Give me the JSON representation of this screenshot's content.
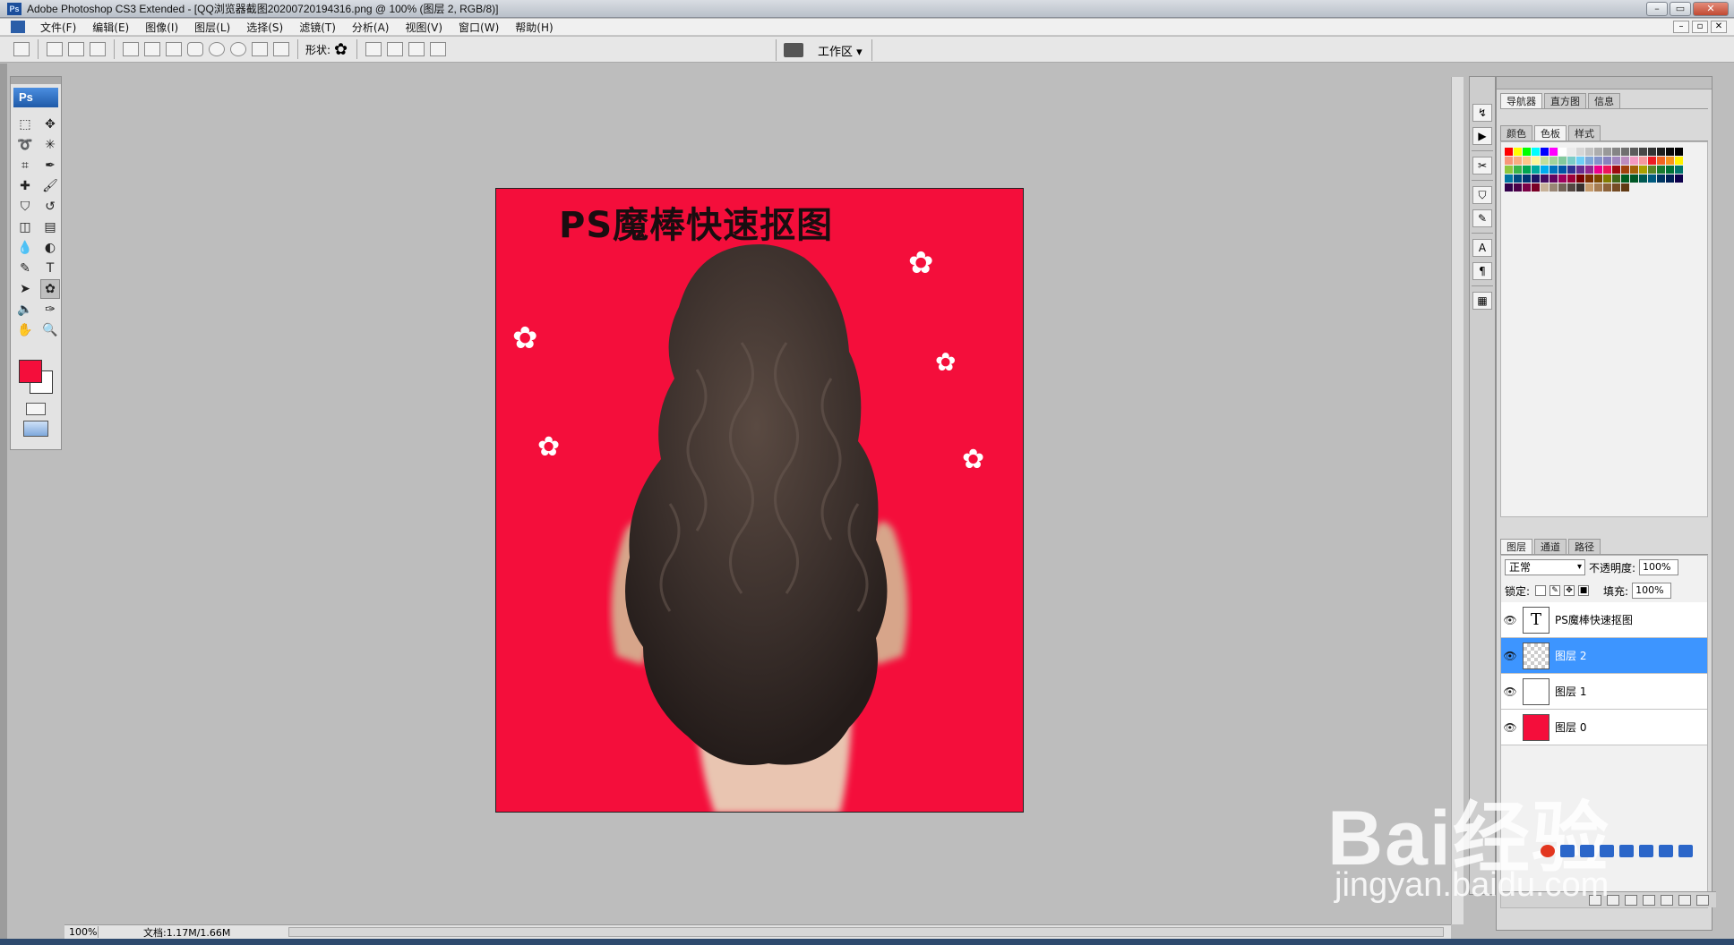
{
  "window": {
    "title": "Adobe Photoshop CS3 Extended - [QQ浏览器截图20200720194316.png @ 100% (图层 2, RGB/8)]",
    "ps_mark": "Ps"
  },
  "menu": [
    "文件(F)",
    "编辑(E)",
    "图像(I)",
    "图层(L)",
    "选择(S)",
    "滤镜(T)",
    "分析(A)",
    "视图(V)",
    "窗口(W)",
    "帮助(H)"
  ],
  "options_bar": {
    "shape_label": "形状:",
    "shape_glyph": "✿",
    "workspace_label": "工作区 ▾"
  },
  "toolbox": {
    "logo": "Ps",
    "foreground_color": "#f40e3b",
    "background_color": "#ffffff",
    "tools": [
      {
        "name": "marquee-tool-icon",
        "glyph": "⬚"
      },
      {
        "name": "move-tool-icon",
        "glyph": "✥"
      },
      {
        "name": "lasso-tool-icon",
        "glyph": "➰"
      },
      {
        "name": "magic-wand-tool-icon",
        "glyph": "✳"
      },
      {
        "name": "crop-tool-icon",
        "glyph": "⌗"
      },
      {
        "name": "slice-tool-icon",
        "glyph": "✒"
      },
      {
        "name": "healing-brush-icon",
        "glyph": "✚"
      },
      {
        "name": "brush-tool-icon",
        "glyph": "🖌"
      },
      {
        "name": "clone-stamp-icon",
        "glyph": "⛉"
      },
      {
        "name": "history-brush-icon",
        "glyph": "↺"
      },
      {
        "name": "eraser-tool-icon",
        "glyph": "◫"
      },
      {
        "name": "gradient-tool-icon",
        "glyph": "▤"
      },
      {
        "name": "blur-tool-icon",
        "glyph": "💧"
      },
      {
        "name": "dodge-tool-icon",
        "glyph": "◐"
      },
      {
        "name": "pen-tool-icon",
        "glyph": "✎"
      },
      {
        "name": "type-tool-icon",
        "glyph": "T"
      },
      {
        "name": "path-selection-icon",
        "glyph": "➤"
      },
      {
        "name": "custom-shape-tool-icon",
        "glyph": "✿"
      },
      {
        "name": "notes-tool-icon",
        "glyph": "🔈"
      },
      {
        "name": "eyedropper-tool-icon",
        "glyph": "✑"
      },
      {
        "name": "hand-tool-icon",
        "glyph": "✋"
      },
      {
        "name": "zoom-tool-icon",
        "glyph": "🔍"
      }
    ]
  },
  "canvas": {
    "text": "PS魔棒快速抠图",
    "background_color": "#f40e3b",
    "flower_glyph": "✿"
  },
  "status": {
    "zoom": "100%",
    "doc": "文档:1.17M/1.66M"
  },
  "panels": {
    "top_tabs": [
      "导航器",
      "直方图",
      "信息"
    ],
    "color_tabs": [
      "颜色",
      "色板",
      "样式"
    ],
    "layer_tabs": [
      "图层",
      "通道",
      "路径"
    ],
    "blend_mode": "正常",
    "opacity_label": "不透明度:",
    "opacity_value": "100%",
    "lock_label": "锁定:",
    "fill_label": "填充:",
    "fill_value": "100%",
    "layers": [
      {
        "name": "PS魔棒快速抠图",
        "thumb": "text",
        "thumb_glyph": "T",
        "selected": false
      },
      {
        "name": "图层 2",
        "thumb": "checker",
        "thumb_glyph": "",
        "selected": true
      },
      {
        "name": "图层 1",
        "thumb": "hair",
        "thumb_glyph": "",
        "selected": false
      },
      {
        "name": "图层 0",
        "thumb": "red",
        "thumb_glyph": "",
        "selected": false
      }
    ],
    "swatches": [
      "#ff0000",
      "#ffff00",
      "#00ff00",
      "#00ffff",
      "#0000ff",
      "#ff00ff",
      "#ffffff",
      "#ebebeb",
      "#d6d6d6",
      "#c2c2c2",
      "#adadad",
      "#999999",
      "#858585",
      "#707070",
      "#5c5c5c",
      "#474747",
      "#333333",
      "#1f1f1f",
      "#0a0a0a",
      "#000000",
      "#f7977a",
      "#f9ad81",
      "#fdc68a",
      "#fff79a",
      "#c4df9b",
      "#a2d39c",
      "#82ca9d",
      "#7bcdc8",
      "#6ecff6",
      "#7ea7d8",
      "#8493ca",
      "#8882be",
      "#a187be",
      "#bc8dbf",
      "#f49ac2",
      "#f6989d",
      "#ed1c24",
      "#f26522",
      "#f7941d",
      "#fff200",
      "#8dc73f",
      "#39b54a",
      "#00a651",
      "#00a99d",
      "#00aeef",
      "#0072bc",
      "#0054a6",
      "#2e3192",
      "#662d91",
      "#92278f",
      "#ec008c",
      "#ed145b",
      "#9e0b0f",
      "#a0410d",
      "#a3620a",
      "#aba000",
      "#598527",
      "#197b30",
      "#007236",
      "#00746b",
      "#0076a3",
      "#004a80",
      "#003471",
      "#1b1464",
      "#440e62",
      "#630460",
      "#9e005d",
      "#9e0039",
      "#790000",
      "#7b2e00",
      "#7d4900",
      "#827b00",
      "#406618",
      "#005e20",
      "#005826",
      "#005952",
      "#005b7f",
      "#003663",
      "#002157",
      "#0d004c",
      "#32004b",
      "#4b0049",
      "#7b0046",
      "#7a0026",
      "#c7b299",
      "#998675",
      "#736357",
      "#534741",
      "#37302d",
      "#c69c6d",
      "#a67c52",
      "#8c6239",
      "#754c24",
      "#603913"
    ],
    "panel_icons": [
      "histogram-icon",
      "actions-icon",
      "tools-icon",
      "clone-source-icon",
      "brush-icon",
      "character-icon",
      "paragraph-icon",
      "layer-comps-icon"
    ]
  },
  "watermark": {
    "main": "Bai经验",
    "sub": "jingyan.baidu.com"
  }
}
